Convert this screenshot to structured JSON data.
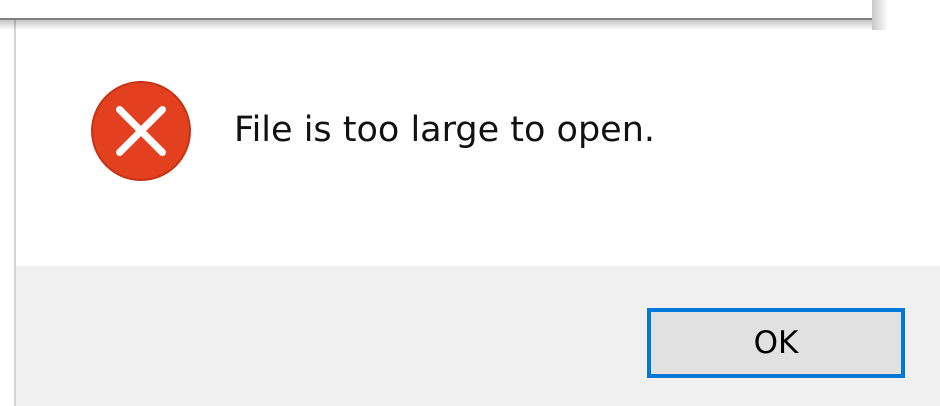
{
  "dialog": {
    "message": "File is too large to open.",
    "icon": "error-icon",
    "ok_label": "OK"
  },
  "colors": {
    "error_red": "#e3401f",
    "button_focus_border": "#0078d7",
    "footer_background": "#f0f0f0"
  }
}
